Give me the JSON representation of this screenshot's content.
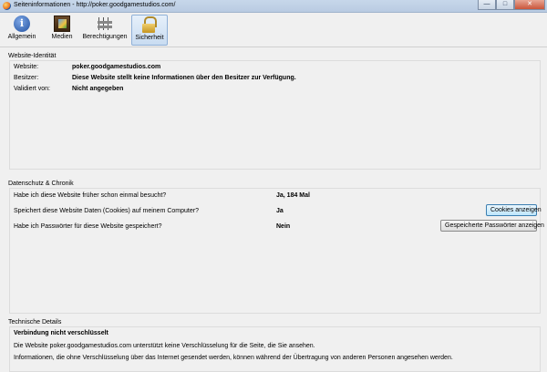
{
  "window": {
    "title": "Seiteninformationen - http://poker.goodgamestudios.com/",
    "minimize": "—",
    "maximize": "□",
    "close": "✕"
  },
  "toolbar": {
    "tabs": [
      {
        "label": "Allgemein",
        "icon": "info-icon"
      },
      {
        "label": "Medien",
        "icon": "media-icon"
      },
      {
        "label": "Berechtigungen",
        "icon": "permissions-icon"
      },
      {
        "label": "Sicherheit",
        "icon": "lock-icon",
        "selected": true
      }
    ],
    "info_glyph": "i"
  },
  "identity": {
    "heading": "Website-Identität",
    "website_label": "Website:",
    "website_value": "poker.goodgamestudios.com",
    "owner_label": "Besitzer:",
    "owner_value": "Diese Website stellt keine Informationen über den Besitzer zur Verfügung.",
    "verified_label": "Validiert von:",
    "verified_value": "Nicht angegeben"
  },
  "privacy": {
    "heading": "Datenschutz & Chronik",
    "q1": "Habe ich diese Website früher schon einmal besucht?",
    "a1": "Ja, 184 Mal",
    "q2": "Speichert diese Website Daten (Cookies) auf meinem Computer?",
    "a2": "Ja",
    "q3": "Habe ich Passwörter für diese Website gespeichert?",
    "a3": "Nein",
    "cookies_button": "Cookies anzeigen",
    "passwords_button": "Gespeicherte Passwörter anzeigen"
  },
  "technical": {
    "heading": "Technische Details",
    "status": "Verbindung nicht verschlüsselt",
    "line1": "Die Website poker.goodgamestudios.com unterstützt keine Verschlüsselung für die Seite, die Sie ansehen.",
    "line2": "Informationen, die ohne Verschlüsselung über das Internet gesendet werden, können während der Übertragung von anderen Personen angesehen werden."
  }
}
